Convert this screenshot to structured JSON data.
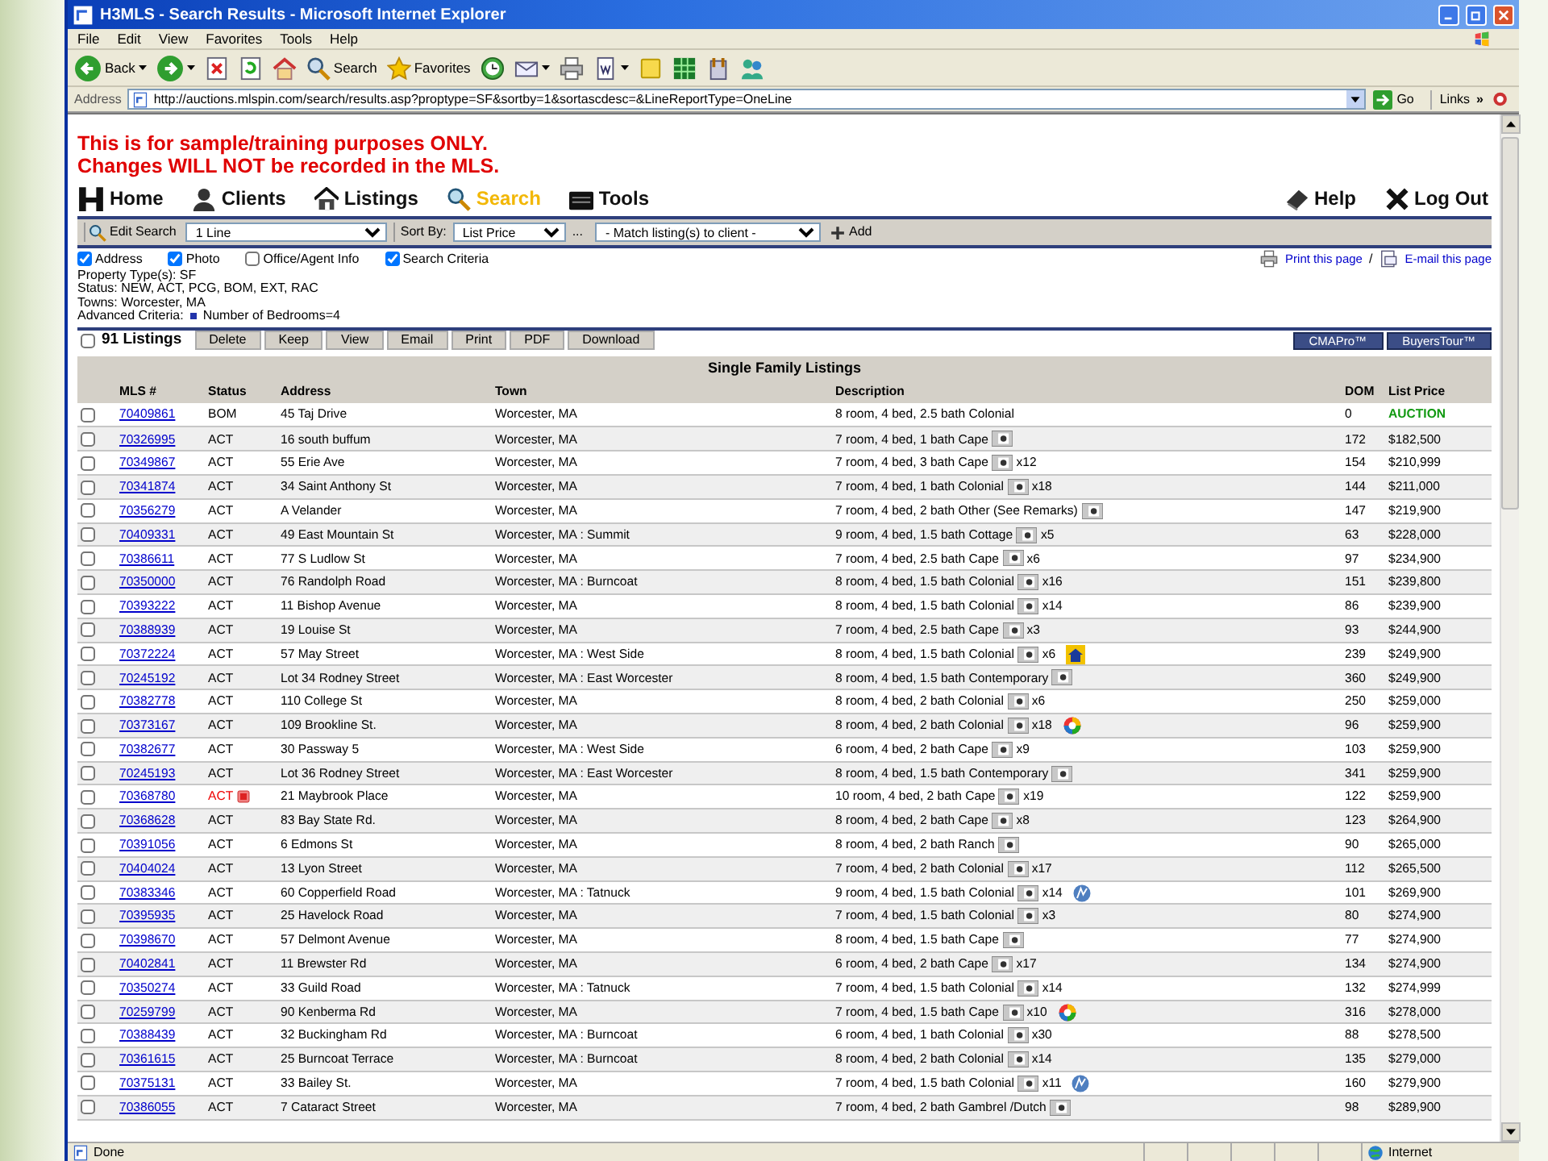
{
  "window": {
    "title": "H3MLS - Search Results - Microsoft Internet Explorer"
  },
  "menu": [
    "File",
    "Edit",
    "View",
    "Favorites",
    "Tools",
    "Help"
  ],
  "toolbar": [
    {
      "kind": "back",
      "label": "Back"
    },
    {
      "kind": "forward"
    },
    {
      "kind": "stop"
    },
    {
      "kind": "refresh"
    },
    {
      "kind": "home"
    },
    {
      "kind": "search",
      "label": "Search"
    },
    {
      "kind": "favorites",
      "label": "Favorites"
    },
    {
      "kind": "history"
    },
    {
      "kind": "mail"
    },
    {
      "kind": "print"
    },
    {
      "kind": "edit"
    },
    {
      "kind": "note"
    },
    {
      "kind": "grid"
    },
    {
      "kind": "tool"
    },
    {
      "kind": "people"
    }
  ],
  "address_bar": {
    "label": "Address",
    "url": "http://auctions.mlspin.com/search/results.asp?proptype=SF&sortby=1&sortascdesc=&LineReportType=OneLine",
    "go": "Go",
    "links": "Links",
    "links_more": "»"
  },
  "notice": [
    "This is for sample/training purposes ONLY.",
    "Changes WILL NOT be recorded in the MLS."
  ],
  "nav": [
    {
      "kind": "home",
      "label": "Home",
      "selected": false
    },
    {
      "kind": "clients",
      "label": "Clients",
      "selected": false
    },
    {
      "kind": "listings",
      "label": "Listings",
      "selected": false
    },
    {
      "kind": "search",
      "label": "Search",
      "selected": true
    },
    {
      "kind": "tools",
      "label": "Tools",
      "selected": false
    }
  ],
  "nav_right": [
    {
      "kind": "help",
      "label": "Help",
      "selected": false
    },
    {
      "kind": "logout",
      "label": "Log Out",
      "selected": false
    }
  ],
  "search_bar": {
    "edit_search": "Edit Search",
    "lines": "1 Line",
    "sort_label": "Sort By:",
    "sort": "List Price",
    "more": "...",
    "match": "- Match listing(s) to client -",
    "add": "Add"
  },
  "display_options": [
    {
      "label": "Address",
      "checked": true
    },
    {
      "label": "Photo",
      "checked": true
    },
    {
      "label": "Office/Agent Info",
      "checked": false
    },
    {
      "label": "Search Criteria",
      "checked": true
    }
  ],
  "page_links": [
    {
      "kind": "print",
      "label": "Print this page"
    },
    {
      "kind": "email",
      "label": "E-mail this page"
    }
  ],
  "page_links_separator": "/",
  "criteria": {
    "lines": [
      "Property Type(s): SF",
      "Status: NEW, ACT, PCG, BOM, EXT, RAC",
      "Towns: Worcester, MA"
    ],
    "advanced_label": "Advanced Criteria:",
    "advanced": "Number of Bedrooms=4"
  },
  "listings_bar": {
    "checked": false,
    "count": "91 Listings",
    "actions": [
      "Delete",
      "Keep",
      "View",
      "Email",
      "Print",
      "PDF",
      "Download"
    ],
    "tools": [
      "CMAPro™",
      "BuyersTour™"
    ]
  },
  "table": {
    "title": "Single Family Listings",
    "columns": [
      "MLS #",
      "Status",
      "Address",
      "Town",
      "Description",
      "DOM",
      "List Price"
    ],
    "rows": [
      {
        "checked": false,
        "mls": "70409861",
        "status": "BOM",
        "alert": false,
        "address": "45 Taj Drive",
        "town": "Worcester, MA",
        "description": "8 room, 4 bed, 2.5 bath Colonial",
        "photo": false,
        "dom": "0",
        "price": "AUCTION",
        "auction": true
      },
      {
        "checked": false,
        "mls": "70326995",
        "status": "ACT",
        "alert": false,
        "address": "16 south buffum",
        "town": "Worcester, MA",
        "description": "7 room, 4 bed, 1 bath Cape",
        "photo": true,
        "dom": "172",
        "price": "$182,500",
        "auction": false
      },
      {
        "checked": false,
        "mls": "70349867",
        "status": "ACT",
        "alert": false,
        "address": "55 Erie Ave",
        "town": "Worcester, MA",
        "description": "7 room, 4 bed, 3 bath Cape",
        "photo": true,
        "photos": "x12",
        "dom": "154",
        "price": "$210,999",
        "auction": false
      },
      {
        "checked": false,
        "mls": "70341874",
        "status": "ACT",
        "alert": false,
        "address": "34 Saint Anthony St",
        "town": "Worcester, MA",
        "description": "7 room, 4 bed, 1 bath Colonial",
        "photo": true,
        "photos": "x18",
        "dom": "144",
        "price": "$211,000",
        "auction": false
      },
      {
        "checked": false,
        "mls": "70356279",
        "status": "ACT",
        "alert": false,
        "address": "A Velander",
        "town": "Worcester, MA",
        "description": "7 room, 4 bed, 2 bath Other (See Remarks)",
        "photo": true,
        "dom": "147",
        "price": "$219,900",
        "auction": false
      },
      {
        "checked": false,
        "mls": "70409331",
        "status": "ACT",
        "alert": false,
        "address": "49 East Mountain St",
        "town": "Worcester, MA : Summit",
        "description": "9 room, 4 bed, 1.5 bath Cottage",
        "photo": true,
        "photos": "x5",
        "dom": "63",
        "price": "$228,000",
        "auction": false
      },
      {
        "checked": false,
        "mls": "70386611",
        "status": "ACT",
        "alert": false,
        "address": "77 S Ludlow St",
        "town": "Worcester, MA",
        "description": "7 room, 4 bed, 2.5 bath Cape",
        "photo": true,
        "photos": "x6",
        "dom": "97",
        "price": "$234,900",
        "auction": false
      },
      {
        "checked": false,
        "mls": "70350000",
        "status": "ACT",
        "alert": false,
        "address": "76 Randolph Road",
        "town": "Worcester, MA : Burncoat",
        "description": "8 room, 4 bed, 1.5 bath Colonial",
        "photo": true,
        "photos": "x16",
        "dom": "151",
        "price": "$239,800",
        "auction": false
      },
      {
        "checked": false,
        "mls": "70393222",
        "status": "ACT",
        "alert": false,
        "address": "11 Bishop Avenue",
        "town": "Worcester, MA",
        "description": "8 room, 4 bed, 1.5 bath Colonial",
        "photo": true,
        "photos": "x14",
        "dom": "86",
        "price": "$239,900",
        "auction": false
      },
      {
        "checked": false,
        "mls": "70388939",
        "status": "ACT",
        "alert": false,
        "address": "19 Louise St",
        "town": "Worcester, MA",
        "description": "7 room, 4 bed, 2.5 bath Cape",
        "photo": true,
        "photos": "x3",
        "dom": "93",
        "price": "$244,900",
        "auction": false
      },
      {
        "checked": false,
        "mls": "70372224",
        "status": "ACT",
        "alert": false,
        "address": "57 May Street",
        "town": "Worcester, MA : West Side",
        "description": "8 room, 4 bed, 1.5 bath Colonial",
        "photo": true,
        "photos": "x6",
        "badge": {
          "kind": "house"
        },
        "dom": "239",
        "price": "$249,900",
        "auction": false
      },
      {
        "checked": false,
        "mls": "70245192",
        "status": "ACT",
        "alert": false,
        "address": "Lot 34 Rodney Street",
        "town": "Worcester, MA : East Worcester",
        "description": "8 room, 4 bed, 1.5 bath Contemporary",
        "photo": true,
        "dom": "360",
        "price": "$249,900",
        "auction": false
      },
      {
        "checked": false,
        "mls": "70382778",
        "status": "ACT",
        "alert": false,
        "address": "110 College St",
        "town": "Worcester, MA",
        "description": "8 room, 4 bed, 2 bath Colonial",
        "photo": true,
        "photos": "x6",
        "dom": "250",
        "price": "$259,000",
        "auction": false
      },
      {
        "checked": false,
        "mls": "70373167",
        "status": "ACT",
        "alert": false,
        "address": "109 Brookline St.",
        "town": "Worcester, MA",
        "description": "8 room, 4 bed, 2 bath Colonial",
        "photo": true,
        "photos": "x18",
        "badge": {
          "kind": "swirl"
        },
        "dom": "96",
        "price": "$259,900",
        "auction": false
      },
      {
        "checked": false,
        "mls": "70382677",
        "status": "ACT",
        "alert": false,
        "address": "30 Passway 5",
        "town": "Worcester, MA : West Side",
        "description": "6 room, 4 bed, 2 bath Cape",
        "photo": true,
        "photos": "x9",
        "dom": "103",
        "price": "$259,900",
        "auction": false
      },
      {
        "checked": false,
        "mls": "70245193",
        "status": "ACT",
        "alert": false,
        "address": "Lot 36 Rodney Street",
        "town": "Worcester, MA : East Worcester",
        "description": "8 room, 4 bed, 1.5 bath Contemporary",
        "photo": true,
        "dom": "341",
        "price": "$259,900",
        "auction": false
      },
      {
        "checked": false,
        "mls": "70368780",
        "status": "ACT",
        "alert": true,
        "address": "21 Maybrook Place",
        "town": "Worcester, MA",
        "description": "10 room, 4 bed, 2 bath Cape",
        "photo": true,
        "photos": "x19",
        "dom": "122",
        "price": "$259,900",
        "auction": false
      },
      {
        "checked": false,
        "mls": "70368628",
        "status": "ACT",
        "alert": false,
        "address": "83 Bay State Rd.",
        "town": "Worcester, MA",
        "description": "8 room, 4 bed, 2 bath Cape",
        "photo": true,
        "photos": "x8",
        "dom": "123",
        "price": "$264,900",
        "auction": false
      },
      {
        "checked": false,
        "mls": "70391056",
        "status": "ACT",
        "alert": false,
        "address": "6 Edmons St",
        "town": "Worcester, MA",
        "description": "8 room, 4 bed, 2 bath Ranch",
        "photo": true,
        "dom": "90",
        "price": "$265,000",
        "auction": false
      },
      {
        "checked": false,
        "mls": "70404024",
        "status": "ACT",
        "alert": false,
        "address": "13 Lyon Street",
        "town": "Worcester, MA",
        "description": "7 room, 4 bed, 2 bath Colonial",
        "photo": true,
        "photos": "x17",
        "dom": "112",
        "price": "$265,500",
        "auction": false
      },
      {
        "checked": false,
        "mls": "70383346",
        "status": "ACT",
        "alert": false,
        "address": "60 Copperfield Road",
        "town": "Worcester, MA : Tatnuck",
        "description": "9 room, 4 bed, 1.5 bath Colonial",
        "photo": true,
        "photos": "x14",
        "badge": {
          "kind": "globe"
        },
        "dom": "101",
        "price": "$269,900",
        "auction": false
      },
      {
        "checked": false,
        "mls": "70395935",
        "status": "ACT",
        "alert": false,
        "address": "25 Havelock Road",
        "town": "Worcester, MA",
        "description": "7 room, 4 bed, 1.5 bath Colonial",
        "photo": true,
        "photos": "x3",
        "dom": "80",
        "price": "$274,900",
        "auction": false
      },
      {
        "checked": false,
        "mls": "70398670",
        "status": "ACT",
        "alert": false,
        "address": "57 Delmont Avenue",
        "town": "Worcester, MA",
        "description": "8 room, 4 bed, 1.5 bath Cape",
        "photo": true,
        "dom": "77",
        "price": "$274,900",
        "auction": false
      },
      {
        "checked": false,
        "mls": "70402841",
        "status": "ACT",
        "alert": false,
        "address": "11 Brewster Rd",
        "town": "Worcester, MA",
        "description": "6 room, 4 bed, 2 bath Cape",
        "photo": true,
        "photos": "x17",
        "dom": "134",
        "price": "$274,900",
        "auction": false
      },
      {
        "checked": false,
        "mls": "70350274",
        "status": "ACT",
        "alert": false,
        "address": "33 Guild Road",
        "town": "Worcester, MA : Tatnuck",
        "description": "7 room, 4 bed, 1.5 bath Colonial",
        "photo": true,
        "photos": "x14",
        "dom": "132",
        "price": "$274,999",
        "auction": false
      },
      {
        "checked": false,
        "mls": "70259799",
        "status": "ACT",
        "alert": false,
        "address": "90 Kenberma Rd",
        "town": "Worcester, MA",
        "description": "7 room, 4 bed, 1.5 bath Cape",
        "photo": true,
        "photos": "x10",
        "badge": {
          "kind": "swirl"
        },
        "dom": "316",
        "price": "$278,000",
        "auction": false
      },
      {
        "checked": false,
        "mls": "70388439",
        "status": "ACT",
        "alert": false,
        "address": "32 Buckingham Rd",
        "town": "Worcester, MA : Burncoat",
        "description": "6 room, 4 bed, 1 bath Colonial",
        "photo": true,
        "photos": "x30",
        "dom": "88",
        "price": "$278,500",
        "auction": false
      },
      {
        "checked": false,
        "mls": "70361615",
        "status": "ACT",
        "alert": false,
        "address": "25 Burncoat Terrace",
        "town": "Worcester, MA : Burncoat",
        "description": "8 room, 4 bed, 2 bath Colonial",
        "photo": true,
        "photos": "x14",
        "dom": "135",
        "price": "$279,000",
        "auction": false
      },
      {
        "checked": false,
        "mls": "70375131",
        "status": "ACT",
        "alert": false,
        "address": "33 Bailey St.",
        "town": "Worcester, MA",
        "description": "7 room, 4 bed, 1.5 bath Colonial",
        "photo": true,
        "photos": "x11",
        "badge": {
          "kind": "globe"
        },
        "dom": "160",
        "price": "$279,900",
        "auction": false
      },
      {
        "checked": false,
        "mls": "70386055",
        "status": "ACT",
        "alert": false,
        "address": "7 Cataract Street",
        "town": "Worcester, MA",
        "description": "7 room, 4 bed, 2 bath Gambrel /Dutch",
        "photo": true,
        "dom": "98",
        "price": "$289,900",
        "auction": false
      }
    ]
  },
  "status_bar": {
    "text": "Done",
    "zone": "Internet"
  }
}
